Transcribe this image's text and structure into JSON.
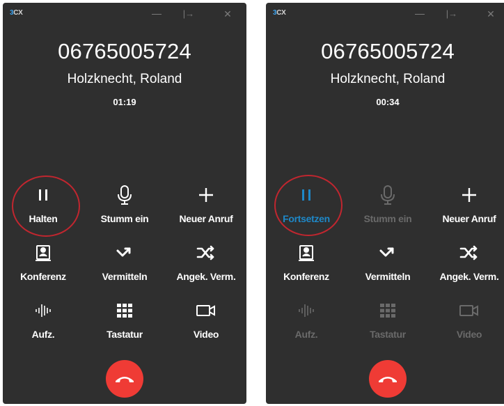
{
  "windows": [
    {
      "app_logo": {
        "prefix": "3",
        "text": "CX"
      },
      "phone_number": "06765005724",
      "contact_name": "Holzknecht, Roland",
      "timer": "01:19",
      "buttons": {
        "hold": "Halten",
        "mute": "Stumm ein",
        "new_call": "Neuer Anruf",
        "conference": "Konferenz",
        "transfer": "Vermitteln",
        "attended_transfer": "Angek. Verm.",
        "record": "Aufz.",
        "keypad": "Tastatur",
        "video": "Video"
      }
    },
    {
      "app_logo": {
        "prefix": "3",
        "text": "CX"
      },
      "phone_number": "06765005724",
      "contact_name": "Holzknecht, Roland",
      "timer": "00:34",
      "buttons": {
        "resume": "Fortsetzen",
        "mute": "Stumm ein",
        "new_call": "Neuer Anruf",
        "conference": "Konferenz",
        "transfer": "Vermitteln",
        "attended_transfer": "Angek. Verm.",
        "record": "Aufz.",
        "keypad": "Tastatur",
        "video": "Video"
      }
    }
  ],
  "colors": {
    "window_bg": "#2f2f2f",
    "text": "#ffffff",
    "disabled_text": "#6a6a6a",
    "active_blue": "#1e88c8",
    "hangup_red": "#ef3b35",
    "highlight_ring": "#c1262f"
  }
}
